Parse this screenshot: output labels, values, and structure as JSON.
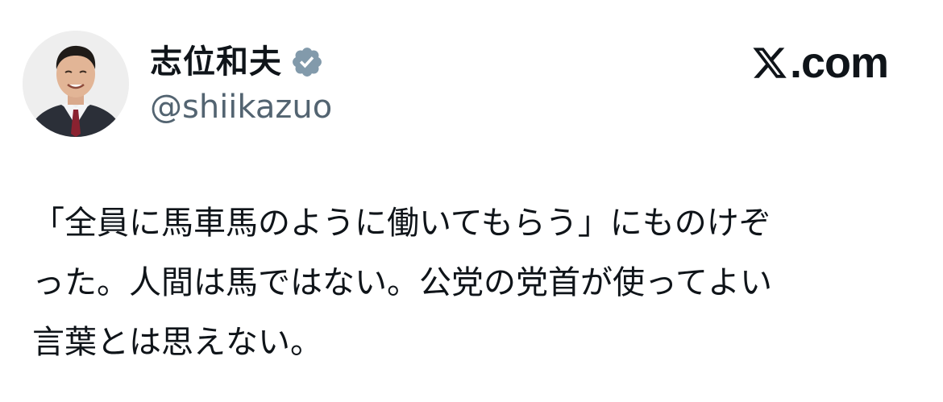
{
  "author": {
    "display_name": "志位和夫",
    "handle": "@shiikazuo",
    "verified": true,
    "verified_color": "#829aab",
    "avatar_icon": "profile-photo"
  },
  "brand": {
    "logo_icon": "x-logo-icon",
    "text": ".com"
  },
  "tweet": {
    "lines": [
      "「全員に馬車馬のように働いてもらう」にものけぞ",
      "った。人間は馬ではない。公党の党首が使ってよい",
      "言葉とは思えない。"
    ]
  },
  "colors": {
    "text": "#0f1419",
    "secondary": "#536471",
    "background": "#ffffff"
  }
}
